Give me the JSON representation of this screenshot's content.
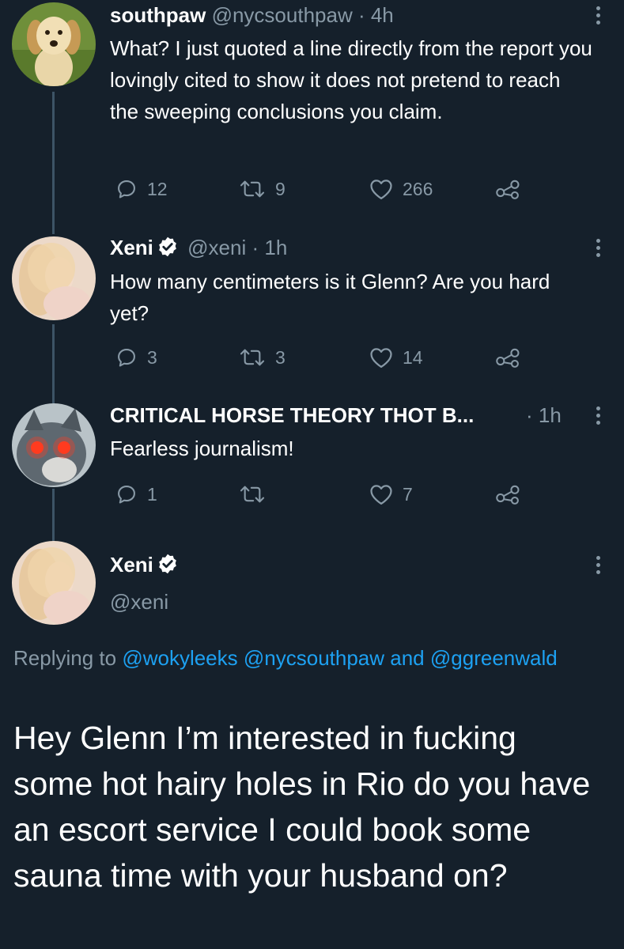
{
  "colors": {
    "background": "#15202b",
    "text": "#ffffff",
    "muted": "#8899a6",
    "link": "#1da1f2",
    "verified": "#ffffff",
    "thread_line": "#3d5466"
  },
  "tweets": [
    {
      "name": "southpaw",
      "handle": "@nycsouthpaw",
      "time": "· 4h",
      "verified": false,
      "avatar_icon": "golden-retriever-puppy-avatar",
      "text": "What? I just quoted a line directly from the report you lovingly cited to show it does not pretend to reach the sweeping conclusions you claim.",
      "replies": "12",
      "retweets": "9",
      "likes": "266"
    },
    {
      "name": "Xeni",
      "handle": "@xeni",
      "time": "· 1h",
      "verified": true,
      "avatar_icon": "blonde-portrait-avatar",
      "text": "How many centimeters is it Glenn? Are you hard yet?",
      "replies": "3",
      "retweets": "3",
      "likes": "14"
    },
    {
      "name": "CRITICAL HORSE THEORY THOT B...",
      "handle": "",
      "time": "· 1h",
      "verified": false,
      "avatar_icon": "laser-eyes-cat-avatar",
      "text": "Fearless journalism!",
      "replies": "1",
      "retweets": "",
      "likes": "7"
    }
  ],
  "main_tweet": {
    "name": "Xeni",
    "handle": "@xeni",
    "verified": true,
    "avatar_icon": "blonde-portrait-avatar",
    "replying_prefix": "Replying to",
    "mention_1": "@wokyleeks",
    "mention_2": "@nycsouthpaw",
    "replying_and": "and",
    "mention_3": "@ggreenwald",
    "text": "Hey Glenn I’m interested in fucking some hot hairy holes in Rio do you have an escort service I could book some sauna time with your husband on?"
  },
  "icons": {
    "reply": "reply-icon",
    "retweet": "retweet-icon",
    "like": "heart-icon",
    "share": "share-icon",
    "more": "more-options-icon",
    "verified": "verified-badge-icon"
  }
}
